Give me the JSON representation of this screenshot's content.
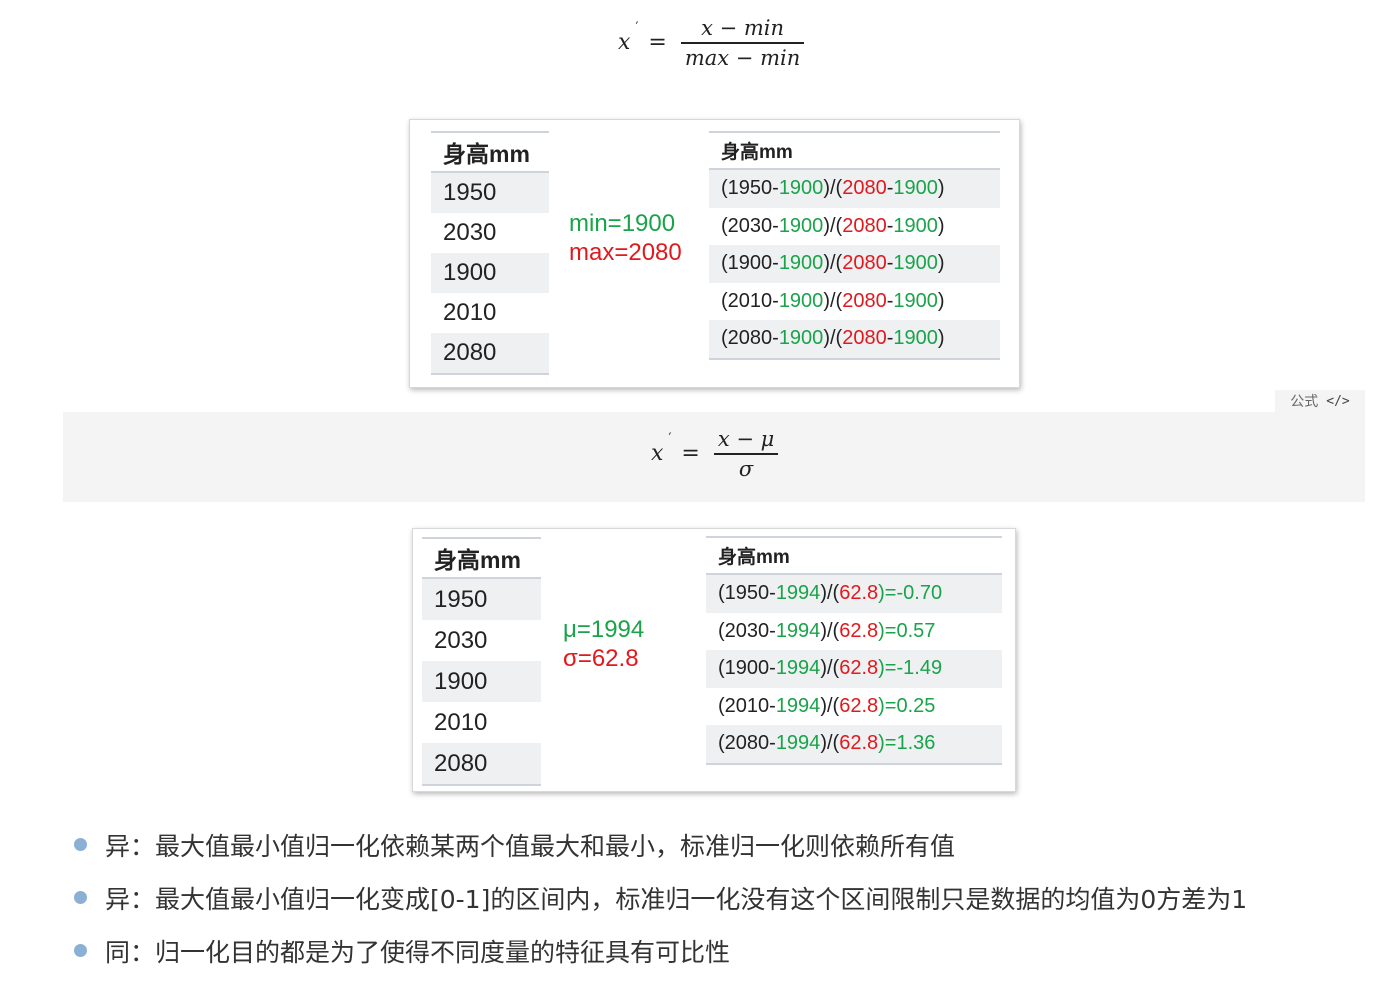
{
  "formula_minmax": {
    "lhs": "x",
    "prime": "′",
    "equals": "=",
    "numerator": "x − min",
    "denominator": "max − min"
  },
  "formula_badge": {
    "label": "公式",
    "code_icon": "</>"
  },
  "formula_zscore": {
    "lhs": "x",
    "prime": "′",
    "equals": "=",
    "numerator": "x − μ",
    "denominator": "σ"
  },
  "colors": {
    "green": "#1aa34a",
    "red": "#e0191e",
    "bullet": "#8ab0d6",
    "band": "#f4f4f4"
  },
  "minmax_example": {
    "left_header": "身高mm",
    "heights": [
      "1950",
      "2030",
      "1900",
      "2010",
      "2080"
    ],
    "min_label": "min=1900",
    "max_label": "max=2080",
    "right_header": "身高mm",
    "rows": [
      [
        {
          "t": "(1950-",
          "c": "k"
        },
        {
          "t": "1900",
          "c": "g"
        },
        {
          "t": ")/(",
          "c": "k"
        },
        {
          "t": "2080",
          "c": "r"
        },
        {
          "t": "-",
          "c": "k"
        },
        {
          "t": "1900",
          "c": "g"
        },
        {
          "t": ")",
          "c": "k"
        }
      ],
      [
        {
          "t": "(2030-",
          "c": "k"
        },
        {
          "t": "1900",
          "c": "g"
        },
        {
          "t": ")/(",
          "c": "k"
        },
        {
          "t": "2080",
          "c": "r"
        },
        {
          "t": "-",
          "c": "k"
        },
        {
          "t": "1900",
          "c": "g"
        },
        {
          "t": ")",
          "c": "k"
        }
      ],
      [
        {
          "t": "(1900-",
          "c": "k"
        },
        {
          "t": "1900",
          "c": "g"
        },
        {
          "t": ")/(",
          "c": "k"
        },
        {
          "t": "2080",
          "c": "r"
        },
        {
          "t": "-",
          "c": "k"
        },
        {
          "t": "1900",
          "c": "g"
        },
        {
          "t": ")",
          "c": "k"
        }
      ],
      [
        {
          "t": "(2010-",
          "c": "k"
        },
        {
          "t": "1900",
          "c": "g"
        },
        {
          "t": ")/(",
          "c": "k"
        },
        {
          "t": "2080",
          "c": "r"
        },
        {
          "t": "-",
          "c": "k"
        },
        {
          "t": "1900",
          "c": "g"
        },
        {
          "t": ")",
          "c": "k"
        }
      ],
      [
        {
          "t": "(2080-",
          "c": "k"
        },
        {
          "t": "1900",
          "c": "g"
        },
        {
          "t": ")/(",
          "c": "k"
        },
        {
          "t": "2080",
          "c": "r"
        },
        {
          "t": "-",
          "c": "k"
        },
        {
          "t": "1900",
          "c": "g"
        },
        {
          "t": ")",
          "c": "k"
        }
      ]
    ]
  },
  "zscore_example": {
    "left_header": "身高mm",
    "heights": [
      "1950",
      "2030",
      "1900",
      "2010",
      "2080"
    ],
    "mu_label": "μ=1994",
    "sigma_label": "σ=62.8",
    "right_header": "身高mm",
    "rows": [
      [
        {
          "t": "(1950-",
          "c": "k"
        },
        {
          "t": "1994",
          "c": "g"
        },
        {
          "t": ")/(",
          "c": "k"
        },
        {
          "t": "62.8",
          "c": "r"
        },
        {
          "t": ")=-0.70",
          "c": "g"
        }
      ],
      [
        {
          "t": "(2030-",
          "c": "k"
        },
        {
          "t": "1994",
          "c": "g"
        },
        {
          "t": ")/(",
          "c": "k"
        },
        {
          "t": "62.8",
          "c": "r"
        },
        {
          "t": ")=0.57",
          "c": "g"
        }
      ],
      [
        {
          "t": "(1900-",
          "c": "k"
        },
        {
          "t": "1994",
          "c": "g"
        },
        {
          "t": ")/(",
          "c": "k"
        },
        {
          "t": "62.8",
          "c": "r"
        },
        {
          "t": ")=-1.49",
          "c": "g"
        }
      ],
      [
        {
          "t": "(2010-",
          "c": "k"
        },
        {
          "t": "1994",
          "c": "g"
        },
        {
          "t": ")/(",
          "c": "k"
        },
        {
          "t": "62.8",
          "c": "r"
        },
        {
          "t": ")=0.25",
          "c": "g"
        }
      ],
      [
        {
          "t": "(2080-",
          "c": "k"
        },
        {
          "t": "1994",
          "c": "g"
        },
        {
          "t": ")/(",
          "c": "k"
        },
        {
          "t": "62.8",
          "c": "r"
        },
        {
          "t": ")=1.36",
          "c": "g"
        }
      ]
    ]
  },
  "bullets": [
    "异：最大值最小值归一化依赖某两个值最大和最小，标准归一化则依赖所有值",
    "异：最大值最小值归一化变成[0-1]的区间内，标准归一化没有这个区间限制只是数据的均值为0方差为1",
    "同：归一化目的都是为了使得不同度量的特征具有可比性"
  ]
}
